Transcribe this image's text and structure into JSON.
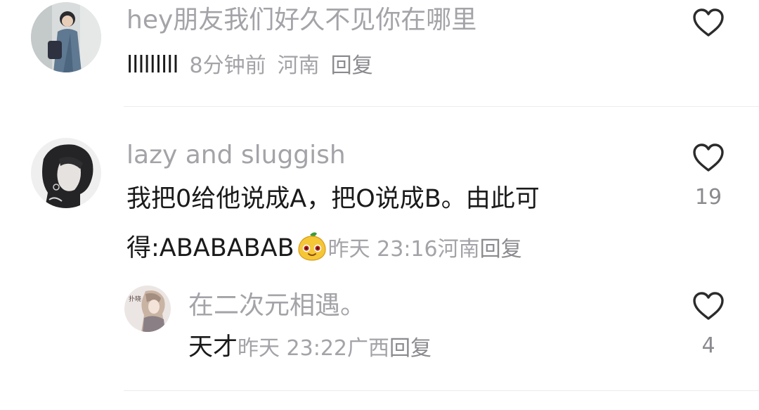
{
  "comments": [
    {
      "username": "hey朋友我们好久不见你在哪里",
      "content": "lllllllll",
      "time": "8分钟前",
      "location": "河南",
      "reply_label": "回复"
    },
    {
      "username": "lazy and sluggish",
      "content_line1": "我把0给他说成A，把O说成B。由此可",
      "content_line2": "得:ABABABAB",
      "emoji": "mango-face-emoji",
      "time": "昨天 23:16",
      "location": "河南",
      "reply_label": "回复",
      "like_count": "19",
      "replies": [
        {
          "username": "在二次元相遇。",
          "content": "天才",
          "time": "昨天 23:22",
          "location": "广西",
          "reply_label": "回复",
          "like_count": "4"
        }
      ]
    }
  ],
  "icons": {
    "like": "heart-outline-icon"
  },
  "colors": {
    "username": "#a3a3a8",
    "text": "#1a1a1a",
    "meta": "#a3a3a8",
    "divider": "#ececec",
    "heart_stroke": "#2b2b2b"
  }
}
